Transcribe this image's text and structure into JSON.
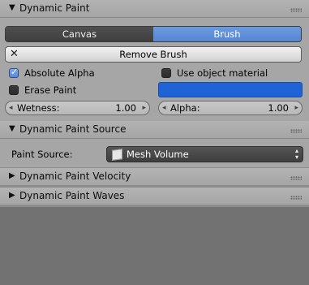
{
  "panels": {
    "dynamic_paint": {
      "title": "Dynamic Paint",
      "expanded": true
    },
    "source": {
      "title": "Dynamic Paint Source",
      "expanded": true
    },
    "velocity": {
      "title": "Dynamic Paint Velocity",
      "expanded": false
    },
    "waves": {
      "title": "Dynamic Paint Waves",
      "expanded": false
    }
  },
  "type_toggle": {
    "options": [
      "Canvas",
      "Brush"
    ],
    "selected": "Brush"
  },
  "remove_button": {
    "label": "Remove Brush"
  },
  "absolute_alpha": {
    "label": "Absolute Alpha",
    "checked": true
  },
  "erase_paint": {
    "label": "Erase Paint",
    "checked": false
  },
  "use_object_material": {
    "label": "Use object material",
    "checked": false
  },
  "paint_color": "#1f63d6",
  "wetness": {
    "label": "Wetness:",
    "value": "1.00"
  },
  "alpha": {
    "label": "Alpha:",
    "value": "1.00"
  },
  "paint_source": {
    "label": "Paint Source:",
    "value": "Mesh Volume"
  },
  "icons": {
    "expanded": "▼",
    "collapsed": "▶",
    "left": "◂",
    "right": "▸",
    "updown": "▴▾"
  }
}
